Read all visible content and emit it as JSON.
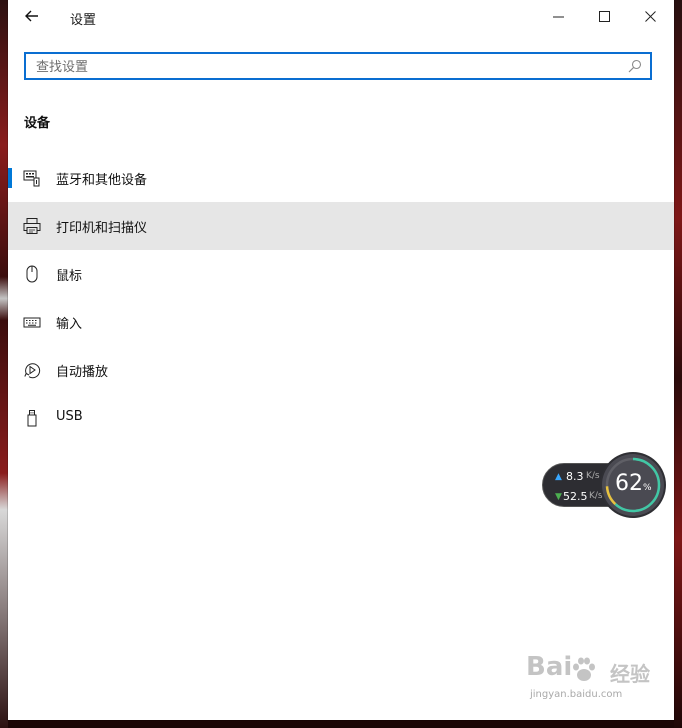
{
  "window": {
    "title": "设置"
  },
  "search": {
    "placeholder": "查找设置",
    "value": ""
  },
  "section": {
    "title": "设备"
  },
  "nav": {
    "items": [
      {
        "label": "蓝牙和其他设备",
        "icon": "bluetooth-devices-icon",
        "selected": true
      },
      {
        "label": "打印机和扫描仪",
        "icon": "printer-icon",
        "hovered": true
      },
      {
        "label": "鼠标",
        "icon": "mouse-icon"
      },
      {
        "label": "输入",
        "icon": "keyboard-icon"
      },
      {
        "label": "自动播放",
        "icon": "autoplay-icon"
      },
      {
        "label": "USB",
        "icon": "usb-icon"
      }
    ]
  },
  "network_widget": {
    "upload_speed": "8.3",
    "upload_unit": "K/s",
    "download_speed": "52.5",
    "download_unit": "K/s",
    "percent": "62",
    "percent_sign": "%"
  },
  "watermark": {
    "logo": "Bai",
    "text": "经验",
    "url": "jingyan.baidu.com"
  },
  "colors": {
    "accent": "#0078d7",
    "search_border": "#0a6ed1",
    "hover_bg": "#e6e6e6",
    "upload_arrow": "#38a7ff",
    "download_arrow": "#4caf50"
  }
}
